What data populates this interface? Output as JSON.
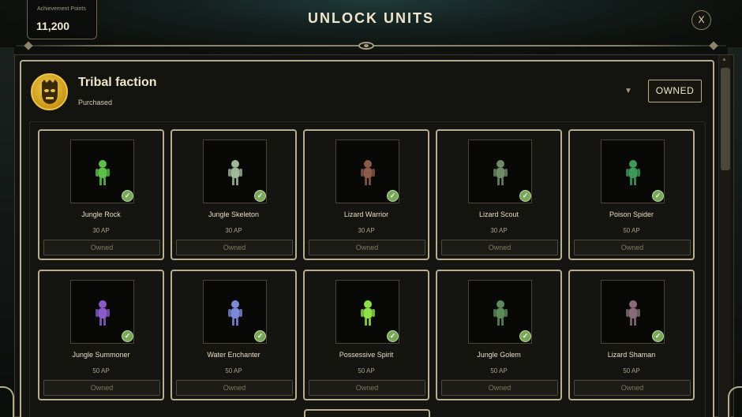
{
  "header": {
    "achievement_label": "Achievement Points",
    "achievement_value": "11,200",
    "title": "UNLOCK UNITS",
    "close_label": "X"
  },
  "faction": {
    "name": "Tribal faction",
    "status": "Purchased",
    "dropdown_glyph": "▼",
    "owned_button": "OWNED",
    "icon": "tribal-mask-icon"
  },
  "units": [
    {
      "name": "Jungle Rock",
      "cost": "30 AP",
      "button": "Owned",
      "color": "#5fbf4a",
      "icon": "jungle-rock-icon"
    },
    {
      "name": "Jungle Skeleton",
      "cost": "30 AP",
      "button": "Owned",
      "color": "#9fb89a",
      "icon": "jungle-skeleton-icon"
    },
    {
      "name": "Lizard Warrior",
      "cost": "30 AP",
      "button": "Owned",
      "color": "#8a5a4a",
      "icon": "lizard-warrior-icon"
    },
    {
      "name": "Lizard Scout",
      "cost": "30 AP",
      "button": "Owned",
      "color": "#6f8a66",
      "icon": "lizard-scout-icon"
    },
    {
      "name": "Poison Spider",
      "cost": "50 AP",
      "button": "Owned",
      "color": "#3f9a5a",
      "icon": "poison-spider-icon"
    },
    {
      "name": "Jungle Summoner",
      "cost": "50 AP",
      "button": "Owned",
      "color": "#8a5ac8",
      "icon": "jungle-summoner-icon"
    },
    {
      "name": "Water Enchanter",
      "cost": "50 AP",
      "button": "Owned",
      "color": "#7a8ad8",
      "icon": "water-enchanter-icon"
    },
    {
      "name": "Possessive Spirit",
      "cost": "50 AP",
      "button": "Owned",
      "color": "#8fe048",
      "icon": "possessive-spirit-icon"
    },
    {
      "name": "Jungle Golem",
      "cost": "50 AP",
      "button": "Owned",
      "color": "#5e8a5a",
      "icon": "jungle-golem-icon"
    },
    {
      "name": "Lizard Shaman",
      "cost": "50 AP",
      "button": "Owned",
      "color": "#8a6a7a",
      "icon": "lizard-shaman-icon"
    }
  ],
  "check_glyph": "✓"
}
